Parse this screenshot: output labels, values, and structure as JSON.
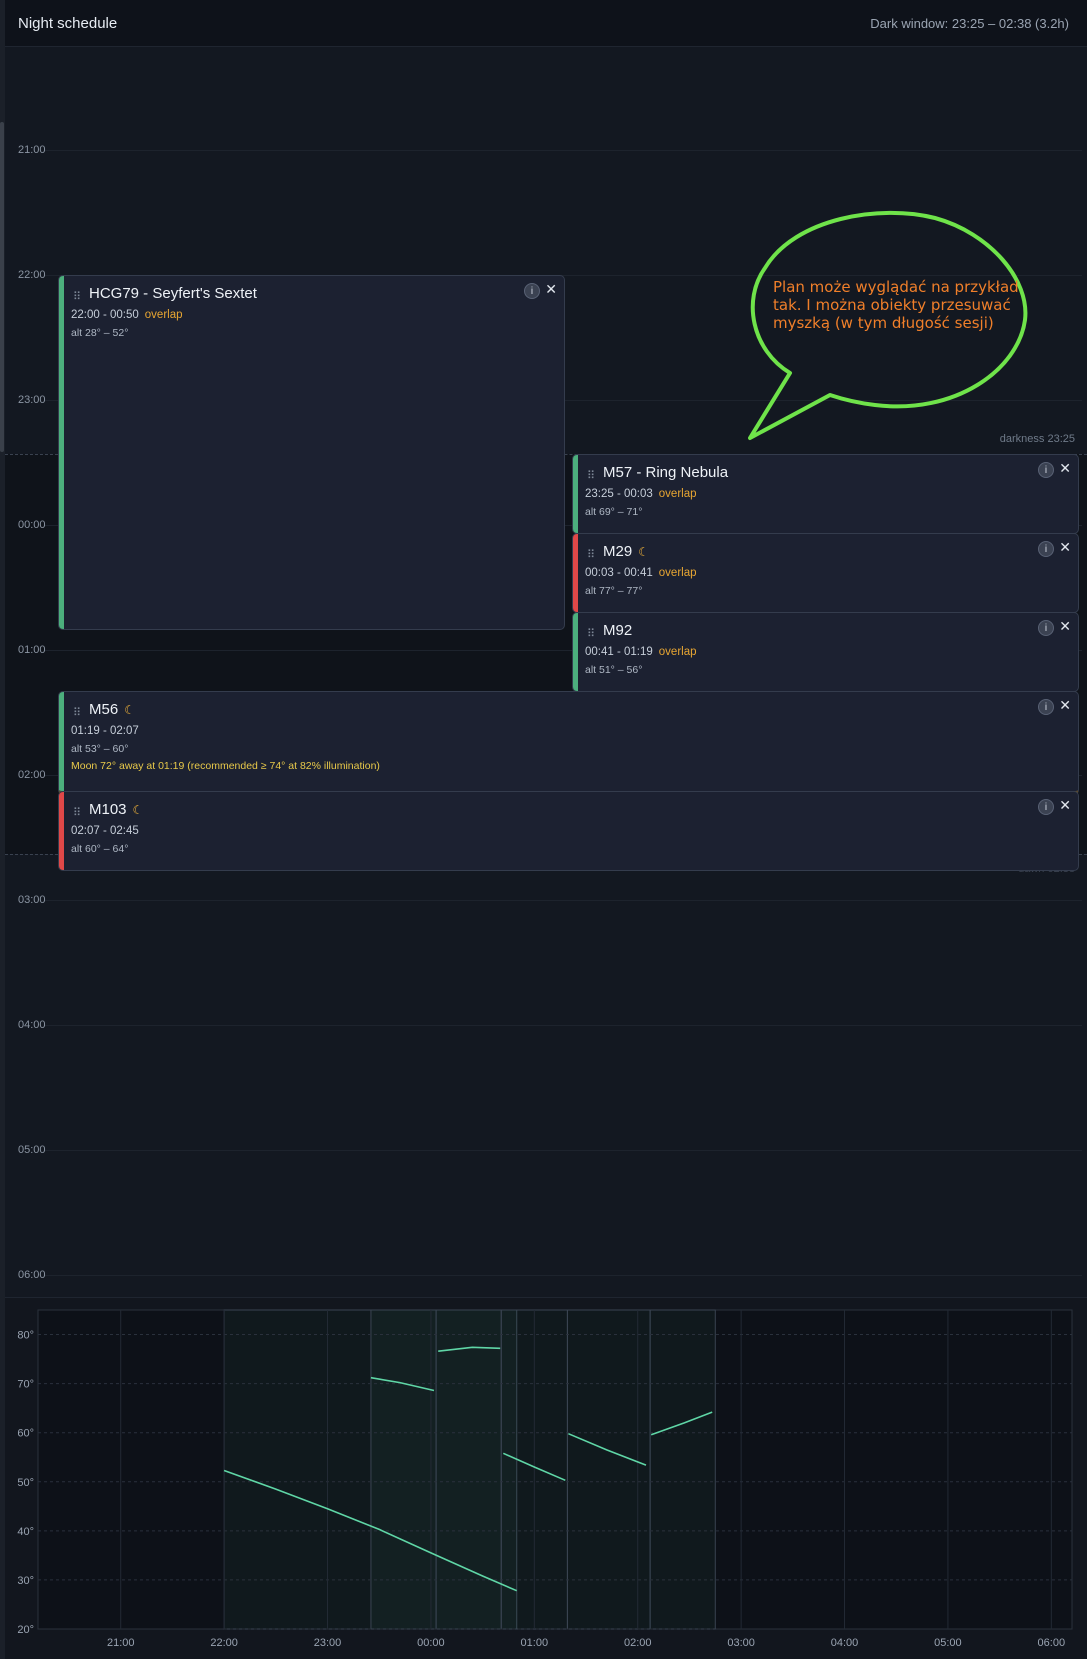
{
  "header": {
    "title": "Night schedule",
    "dark_window": "Dark window: 23:25 – 02:38 (3.2h)"
  },
  "timeline": {
    "hours": [
      "21:00",
      "22:00",
      "23:00",
      "00:00",
      "01:00",
      "02:00",
      "03:00",
      "04:00",
      "05:00",
      "06:00"
    ],
    "darkness_label": "darkness 23:25",
    "dawn_label": "dawn 02:38"
  },
  "annotation": {
    "text": "Plan może wyglądać na przykład tak. I można obiekty przesuwać myszką (w tym długość sesji)"
  },
  "targets": [
    {
      "name": "HCG79 - Seyfert's Sextet",
      "time": "22:00 - 00:50",
      "overlap": "overlap",
      "alt": "alt 28° – 52°",
      "status": "green",
      "moon": false
    },
    {
      "name": "M57 - Ring Nebula",
      "time": "23:25 - 00:03",
      "overlap": "overlap",
      "alt": "alt 69° – 71°",
      "status": "green",
      "moon": false
    },
    {
      "name": "M29",
      "time": "00:03 - 00:41",
      "overlap": "overlap",
      "alt": "alt 77° – 77°",
      "status": "red",
      "moon": true
    },
    {
      "name": "M92",
      "time": "00:41 - 01:19",
      "overlap": "overlap",
      "alt": "alt 51° – 56°",
      "status": "green",
      "moon": false
    },
    {
      "name": "M56",
      "time": "01:19 - 02:07",
      "overlap": "",
      "alt": "alt 53° – 60°",
      "status": "green",
      "moon": true,
      "warning": "Moon 72° away at 01:19 (recommended ≥ 74° at 82% illumination)"
    },
    {
      "name": "M103",
      "time": "02:07 - 02:45",
      "overlap": "",
      "alt": "alt 60° – 64°",
      "status": "red",
      "moon": true
    }
  ],
  "icons": {
    "grip": "drag-handle-icon",
    "info": "info-icon",
    "close": "close-icon",
    "moon": "moon-icon"
  },
  "colors": {
    "accent_green": "#4caf7d",
    "alert_red": "#e04848",
    "overlap_orange": "#e8a632",
    "curve": "#5fd6a6",
    "callout_stroke": "#6fe34a",
    "callout_text": "#f07f2a"
  },
  "chart_data": {
    "type": "line",
    "title": "",
    "xlabel": "",
    "ylabel": "",
    "xticks": [
      "21:00",
      "22:00",
      "23:00",
      "00:00",
      "01:00",
      "02:00",
      "03:00",
      "04:00",
      "05:00",
      "06:00"
    ],
    "yticks": [
      "20°",
      "30°",
      "40°",
      "50°",
      "60°",
      "70°",
      "80°"
    ],
    "ylim": [
      20,
      85
    ],
    "xlim_hours": [
      20.2,
      30.2
    ],
    "grid": true,
    "session_windows": [
      {
        "start": 22.0,
        "end": 24.83
      },
      {
        "start": 23.42,
        "end": 24.05
      },
      {
        "start": 24.05,
        "end": 24.68
      },
      {
        "start": 24.68,
        "end": 25.32
      },
      {
        "start": 25.32,
        "end": 26.12
      },
      {
        "start": 26.12,
        "end": 26.75
      }
    ],
    "series": [
      {
        "x": [
          22.0,
          22.5,
          23.0,
          23.5,
          24.0,
          24.5,
          24.83
        ],
        "y": [
          52.3,
          48.5,
          44.5,
          40.3,
          35.5,
          30.8,
          27.8
        ]
      },
      {
        "x": [
          23.42,
          23.7,
          24.03
        ],
        "y": [
          71.2,
          70.2,
          68.6
        ]
      },
      {
        "x": [
          24.07,
          24.4,
          24.67
        ],
        "y": [
          76.6,
          77.4,
          77.2
        ]
      },
      {
        "x": [
          24.7,
          25.0,
          25.3
        ],
        "y": [
          55.8,
          53.0,
          50.3
        ]
      },
      {
        "x": [
          25.33,
          25.7,
          26.08
        ],
        "y": [
          59.8,
          56.5,
          53.4
        ]
      },
      {
        "x": [
          26.13,
          26.45,
          26.72
        ],
        "y": [
          59.6,
          62.0,
          64.2
        ]
      }
    ]
  }
}
